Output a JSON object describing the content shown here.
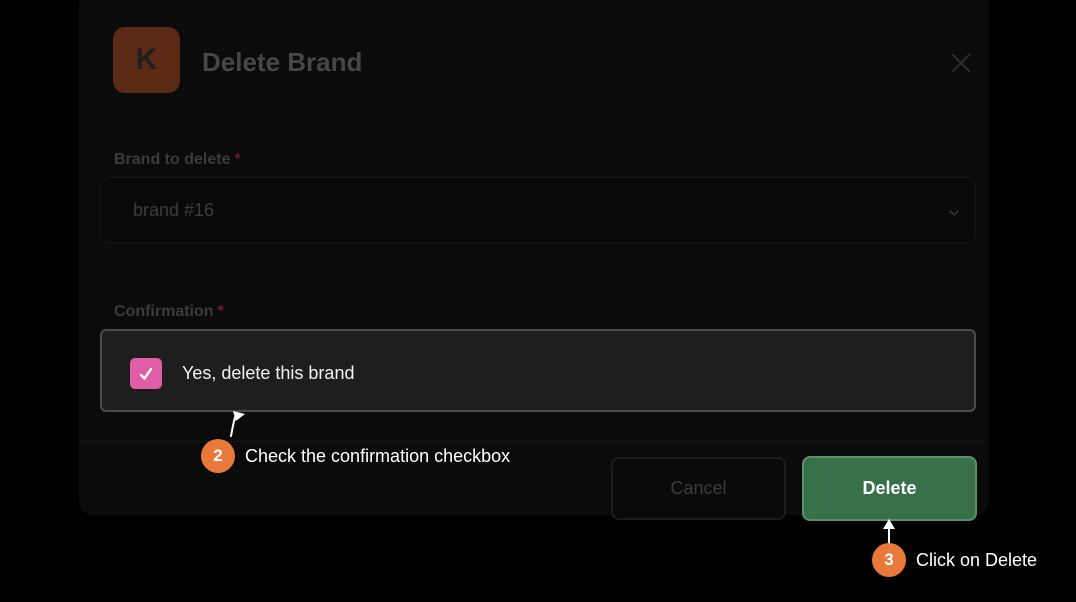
{
  "dialog": {
    "logo_letter": "K",
    "title": "Delete Brand"
  },
  "fields": {
    "brand": {
      "label": "Brand to delete",
      "required_marker": "*",
      "value": "brand #16"
    },
    "confirmation": {
      "label": "Confirmation",
      "required_marker": "*",
      "checkbox_label": "Yes, delete this brand",
      "checked": true
    }
  },
  "buttons": {
    "cancel": "Cancel",
    "delete": "Delete"
  },
  "annotations": [
    {
      "step": "2",
      "text": "Check the confirmation checkbox"
    },
    {
      "step": "3",
      "text": "Click on Delete"
    }
  ],
  "colors": {
    "checkbox": "#e05ea6",
    "delete_button": "#38704a",
    "step_badge": "#e8793a"
  }
}
